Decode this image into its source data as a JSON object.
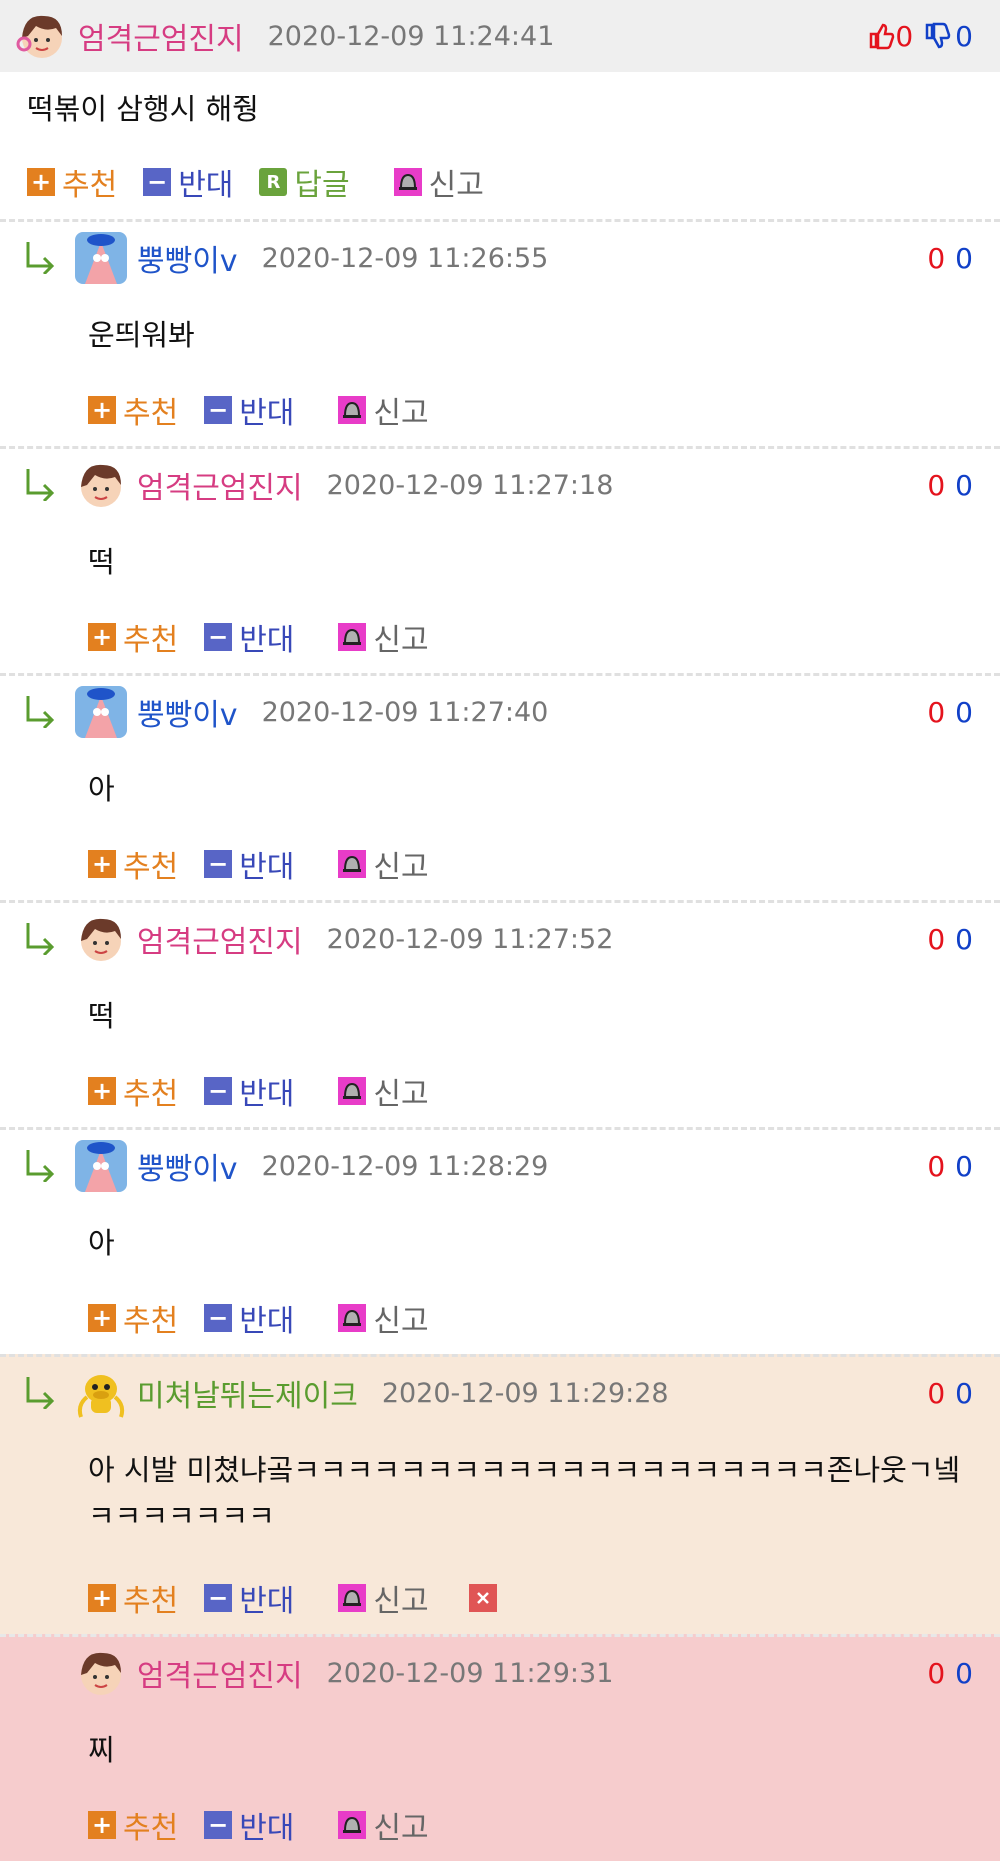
{
  "post": {
    "nick": "엄격근엄진지",
    "time": "2020-12-09 11:24:41",
    "up": "0",
    "down": "0",
    "text": "떡볶이 삼행시 해줭"
  },
  "actions": {
    "recommend": "추천",
    "oppose": "반대",
    "reply": "답글",
    "report": "신고"
  },
  "colors": {
    "pink_nick": "#d63c82",
    "blue_nick": "#1f54c9",
    "green_nick": "#5a9c2f"
  },
  "replies": [
    {
      "nick": "뿡빵이v",
      "time": "2020-12-09 11:26:55",
      "text": "운띄워봐",
      "up": "0",
      "down": "0"
    },
    {
      "nick": "엄격근엄진지",
      "time": "2020-12-09 11:27:18",
      "text": "떡",
      "up": "0",
      "down": "0"
    },
    {
      "nick": "뿡빵이v",
      "time": "2020-12-09 11:27:40",
      "text": "아",
      "up": "0",
      "down": "0"
    },
    {
      "nick": "엄격근엄진지",
      "time": "2020-12-09 11:27:52",
      "text": "떡",
      "up": "0",
      "down": "0"
    },
    {
      "nick": "뿡빵이v",
      "time": "2020-12-09 11:28:29",
      "text": "아",
      "up": "0",
      "down": "0"
    },
    {
      "nick": "미쳐날뛰는제이크",
      "time": "2020-12-09 11:29:28",
      "text": "아 시발 미쳤냐곸ㅋㅋㅋㅋㅋㅋㅋㅋㅋㅋㅋㅋㅋㅋㅋㅋㅋㅋㅋㅋ존나웃ㄱ넼ㅋㅋㅋㅋㅋㅋㅋ",
      "up": "0",
      "down": "0"
    },
    {
      "nick": "엄격근엄진지",
      "time": "2020-12-09 11:29:31",
      "text": "찌",
      "up": "0",
      "down": "0"
    }
  ]
}
